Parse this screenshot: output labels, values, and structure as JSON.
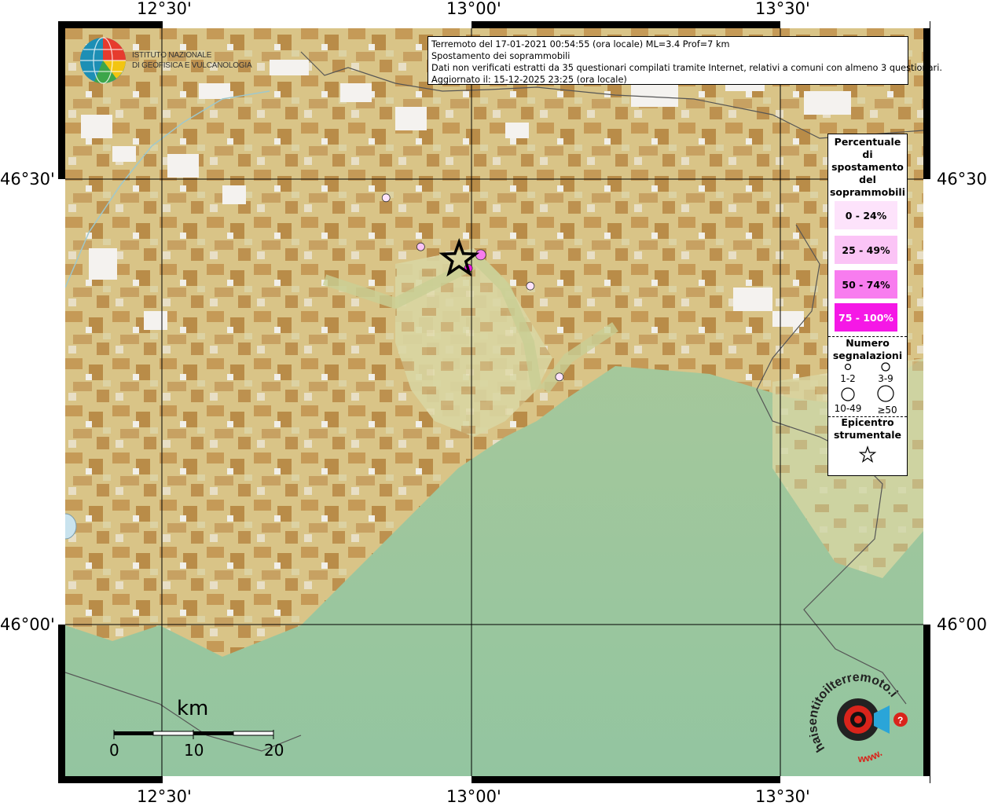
{
  "coordinates": {
    "top": [
      "12°30'",
      "13°00'",
      "13°30'"
    ],
    "bottom": [
      "12°30'",
      "13°00'",
      "13°30'"
    ],
    "left": [
      "46°30'",
      "46°00'"
    ],
    "right": [
      "46°30'",
      "46°00'"
    ]
  },
  "info": {
    "line1": "Terremoto del 17-01-2021 00:54:55 (ora locale) ML=3.4 Prof=7 km",
    "line2": "Spostamento dei soprammobili",
    "line3": "Dati non verificati estratti da 35 questionari compilati tramite Internet, relativi a comuni con almeno 3 questionari.",
    "line4": "Aggiornato il: 15-12-2025 23:25 (ora locale)"
  },
  "logo": {
    "line1": "ISTITUTO NAZIONALE",
    "line2": "DI GEOFISICA E VULCANOLOGIA"
  },
  "legend": {
    "title": [
      "Percentuale",
      "di",
      "spostamento",
      "del",
      "soprammobili"
    ],
    "classes": [
      {
        "label": "0 - 24%",
        "color": "#fde3fb"
      },
      {
        "label": "25 - 49%",
        "color": "#fbc4f6"
      },
      {
        "label": "50 - 74%",
        "color": "#f87cef"
      },
      {
        "label": "75 - 100%",
        "color": "#f518e6"
      }
    ],
    "count_title": [
      "Numero",
      "segnalazioni"
    ],
    "count_sizes": [
      "1-2",
      "3-9",
      "10-49",
      "≥50"
    ],
    "epicenter_title": [
      "Epicentro",
      "strumentale"
    ]
  },
  "scale": {
    "unit": "km",
    "ticks": [
      "0",
      "10",
      "20"
    ]
  },
  "watermark": {
    "text": "haisentitoilterremoto.it",
    "url": "www."
  },
  "colors": {
    "plain_green": "#8fbd8a",
    "foothill_yellow": "#dccf98",
    "mountain_brown": "#c79a55",
    "peak_white": "#f4f2ef",
    "marker_outline": "#000000"
  },
  "epicenter": {
    "lat": 46.41,
    "lon": 12.98
  },
  "observations": [
    {
      "lat": 46.479,
      "lon": 12.862,
      "percent_class": "0 - 24%",
      "count_class": "1-2"
    },
    {
      "lat": 46.424,
      "lon": 12.918,
      "percent_class": "25 - 49%",
      "count_class": "1-2"
    },
    {
      "lat": 46.415,
      "lon": 13.015,
      "percent_class": "50 - 74%",
      "count_class": "3-9"
    },
    {
      "lat": 46.4,
      "lon": 12.995,
      "percent_class": "75 - 100%",
      "count_class": "1-2"
    },
    {
      "lat": 46.38,
      "lon": 13.095,
      "percent_class": "0 - 24%",
      "count_class": "1-2"
    },
    {
      "lat": 46.278,
      "lon": 13.142,
      "percent_class": "0 - 24%",
      "count_class": "1-2"
    }
  ]
}
